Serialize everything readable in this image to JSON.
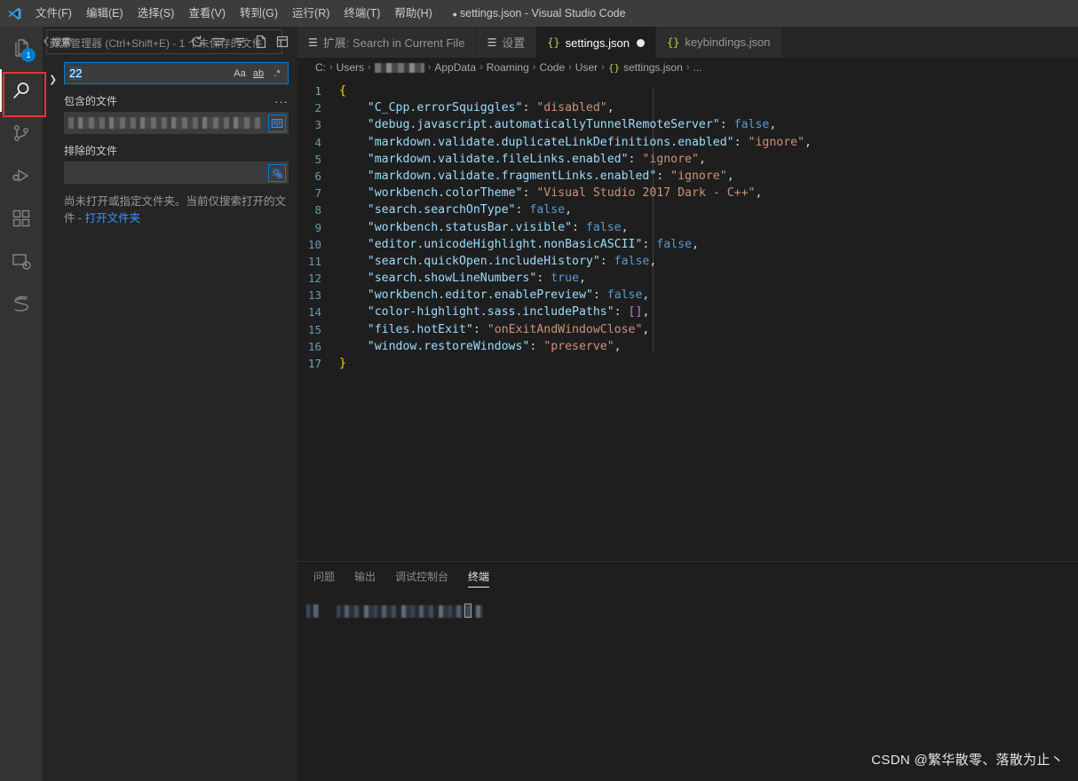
{
  "window": {
    "title": "settings.json - Visual Studio Code",
    "dirty_dot": "●",
    "logo_name": "vscode-logo"
  },
  "menubar": {
    "items": [
      {
        "label": "文件(F)",
        "name": "menu-file"
      },
      {
        "label": "编辑(E)",
        "name": "menu-edit"
      },
      {
        "label": "选择(S)",
        "name": "menu-selection"
      },
      {
        "label": "查看(V)",
        "name": "menu-view"
      },
      {
        "label": "转到(G)",
        "name": "menu-go"
      },
      {
        "label": "运行(R)",
        "name": "menu-run"
      },
      {
        "label": "终端(T)",
        "name": "menu-terminal"
      },
      {
        "label": "帮助(H)",
        "name": "menu-help"
      }
    ]
  },
  "activitybar": {
    "items": [
      {
        "icon": "files-explorer-icon",
        "active": false,
        "badge": "1"
      },
      {
        "icon": "search-icon",
        "active": true,
        "badge": ""
      },
      {
        "icon": "source-control-icon",
        "active": false,
        "badge": ""
      },
      {
        "icon": "run-and-debug-icon",
        "active": false,
        "badge": ""
      },
      {
        "icon": "extensions-icon",
        "active": false,
        "badge": ""
      },
      {
        "icon": "remote-explorer-icon",
        "active": false,
        "badge": ""
      },
      {
        "icon": "sass-icon",
        "active": false,
        "badge": ""
      }
    ],
    "annotation_color": "#e83333"
  },
  "sidebar": {
    "title": "搜索",
    "ghost_tooltip": "资源管理器 (Ctrl+Shift+E) - 1 个未保存的文件",
    "header_icons": [
      {
        "name": "refresh-icon"
      },
      {
        "name": "clear-search-results-icon"
      },
      {
        "name": "collapse-all-icon"
      },
      {
        "name": "open-new-search-editor-icon"
      },
      {
        "name": "view-as-tree-icon"
      }
    ],
    "toggle_details_arrow": "❯",
    "search": {
      "value": "22",
      "options": [
        {
          "label": "Aa",
          "name": "match-case-option"
        },
        {
          "label": "ab",
          "name": "match-whole-word-option"
        },
        {
          "label": ".*",
          "name": "use-regex-option"
        }
      ]
    },
    "files_to_include": {
      "label": "包含的文件",
      "value": "",
      "ellipsis": "...",
      "button_icon": "open-editors-icon"
    },
    "files_to_exclude": {
      "label": "排除的文件",
      "value": "",
      "button_icon": "settings-gear-exclude-icon"
    },
    "hint": {
      "text": "尚未打开或指定文件夹。当前仅搜索打开的文件 - ",
      "link": "打开文件夹"
    }
  },
  "editor": {
    "tabs": [
      {
        "label": "扩展: Search in Current File",
        "icon": "settings-lines-icon",
        "active": false,
        "dirty": false,
        "icon_kind": "lines"
      },
      {
        "label": "设置",
        "icon": "settings-lines-icon",
        "active": false,
        "dirty": false,
        "icon_kind": "lines"
      },
      {
        "label": "settings.json",
        "icon": "json-braces-icon",
        "active": true,
        "dirty": true,
        "icon_kind": "json"
      },
      {
        "label": "keybindings.json",
        "icon": "json-braces-icon",
        "active": false,
        "dirty": false,
        "icon_kind": "json"
      }
    ],
    "breadcrumb": [
      {
        "type": "text",
        "label": "C:"
      },
      {
        "type": "text",
        "label": "Users"
      },
      {
        "type": "redacted",
        "label": ""
      },
      {
        "type": "text",
        "label": "AppData"
      },
      {
        "type": "text",
        "label": "Roaming"
      },
      {
        "type": "text",
        "label": "Code"
      },
      {
        "type": "text",
        "label": "User"
      },
      {
        "type": "json",
        "label": "settings.json"
      },
      {
        "type": "text",
        "label": "..."
      }
    ],
    "breadcrumb_separator": "›",
    "code_lines": [
      {
        "n": "1",
        "tokens": [
          {
            "t": "{",
            "c": "brace"
          }
        ]
      },
      {
        "n": "2",
        "tokens": [
          {
            "t": "    \"C_Cpp.errorSquiggles\"",
            "c": "prop"
          },
          {
            "t": ": ",
            "c": "punc"
          },
          {
            "t": "\"disabled\"",
            "c": "str"
          },
          {
            "t": ",",
            "c": "punc"
          }
        ]
      },
      {
        "n": "3",
        "tokens": [
          {
            "t": "    \"debug.javascript.automaticallyTunnelRemoteServer\"",
            "c": "prop"
          },
          {
            "t": ": ",
            "c": "punc"
          },
          {
            "t": "false",
            "c": "bool"
          },
          {
            "t": ",",
            "c": "punc"
          }
        ]
      },
      {
        "n": "4",
        "tokens": [
          {
            "t": "    \"markdown.validate.duplicateLinkDefinitions.enabled\"",
            "c": "prop"
          },
          {
            "t": ": ",
            "c": "punc"
          },
          {
            "t": "\"ignore\"",
            "c": "str"
          },
          {
            "t": ",",
            "c": "punc"
          }
        ]
      },
      {
        "n": "5",
        "tokens": [
          {
            "t": "    \"markdown.validate.fileLinks.enabled\"",
            "c": "prop"
          },
          {
            "t": ": ",
            "c": "punc"
          },
          {
            "t": "\"ignore\"",
            "c": "str"
          },
          {
            "t": ",",
            "c": "punc"
          }
        ]
      },
      {
        "n": "6",
        "tokens": [
          {
            "t": "    \"markdown.validate.fragmentLinks.enabled\"",
            "c": "prop"
          },
          {
            "t": ": ",
            "c": "punc"
          },
          {
            "t": "\"ignore\"",
            "c": "str"
          },
          {
            "t": ",",
            "c": "punc"
          }
        ]
      },
      {
        "n": "7",
        "tokens": [
          {
            "t": "    \"workbench.colorTheme\"",
            "c": "prop"
          },
          {
            "t": ": ",
            "c": "punc"
          },
          {
            "t": "\"Visual Studio 2017 Dark - C++\"",
            "c": "str"
          },
          {
            "t": ",",
            "c": "punc"
          }
        ]
      },
      {
        "n": "8",
        "tokens": [
          {
            "t": "    \"search.searchOnType\"",
            "c": "prop"
          },
          {
            "t": ": ",
            "c": "punc"
          },
          {
            "t": "false",
            "c": "bool"
          },
          {
            "t": ",",
            "c": "punc"
          }
        ]
      },
      {
        "n": "9",
        "tokens": [
          {
            "t": "    \"workbench.statusBar.visible\"",
            "c": "prop"
          },
          {
            "t": ": ",
            "c": "punc"
          },
          {
            "t": "false",
            "c": "bool"
          },
          {
            "t": ",",
            "c": "punc"
          }
        ]
      },
      {
        "n": "10",
        "tokens": [
          {
            "t": "    \"editor.unicodeHighlight.nonBasicASCII\"",
            "c": "prop"
          },
          {
            "t": ": ",
            "c": "punc"
          },
          {
            "t": "false",
            "c": "bool"
          },
          {
            "t": ",",
            "c": "punc"
          }
        ]
      },
      {
        "n": "11",
        "tokens": [
          {
            "t": "    \"search.quickOpen.includeHistory\"",
            "c": "prop"
          },
          {
            "t": ": ",
            "c": "punc"
          },
          {
            "t": "false",
            "c": "bool"
          },
          {
            "t": ",",
            "c": "punc"
          }
        ]
      },
      {
        "n": "12",
        "tokens": [
          {
            "t": "    \"search.showLineNumbers\"",
            "c": "prop"
          },
          {
            "t": ": ",
            "c": "punc"
          },
          {
            "t": "true",
            "c": "bool"
          },
          {
            "t": ",",
            "c": "punc"
          }
        ]
      },
      {
        "n": "13",
        "tokens": [
          {
            "t": "    \"workbench.editor.enablePreview\"",
            "c": "prop"
          },
          {
            "t": ": ",
            "c": "punc"
          },
          {
            "t": "false",
            "c": "bool"
          },
          {
            "t": ",",
            "c": "punc"
          }
        ]
      },
      {
        "n": "14",
        "tokens": [
          {
            "t": "    \"color-highlight.sass.includePaths\"",
            "c": "prop"
          },
          {
            "t": ": ",
            "c": "punc"
          },
          {
            "t": "[]",
            "c": "brack"
          },
          {
            "t": ",",
            "c": "punc"
          }
        ]
      },
      {
        "n": "15",
        "tokens": [
          {
            "t": "    \"files.hotExit\"",
            "c": "prop"
          },
          {
            "t": ": ",
            "c": "punc"
          },
          {
            "t": "\"onExitAndWindowClose\"",
            "c": "str"
          },
          {
            "t": ",",
            "c": "punc"
          }
        ]
      },
      {
        "n": "16",
        "tokens": [
          {
            "t": "    \"window.restoreWindows\"",
            "c": "prop"
          },
          {
            "t": ": ",
            "c": "punc"
          },
          {
            "t": "\"preserve\"",
            "c": "str"
          },
          {
            "t": ",",
            "c": "punc"
          }
        ]
      },
      {
        "n": "17",
        "tokens": [
          {
            "t": "}",
            "c": "brace"
          }
        ]
      }
    ]
  },
  "panel": {
    "tabs": [
      {
        "label": "问题",
        "active": false
      },
      {
        "label": "输出",
        "active": false
      },
      {
        "label": "调试控制台",
        "active": false
      },
      {
        "label": "终端",
        "active": true
      }
    ],
    "terminal": {
      "content": "",
      "cursor": true
    }
  },
  "watermark": {
    "text": "CSDN @繁华散零、落散为止丶"
  },
  "colors": {
    "accent": "#007acc",
    "focus_border": "#007fd4",
    "editor_bg": "#1e1e1e",
    "sidebar_bg": "#252526",
    "activitybar_bg": "#333333",
    "titlebar_bg": "#3c3c3c",
    "annotation": "#e83333",
    "link": "#3794ff",
    "json_key": "#9cdcfe",
    "json_string": "#ce9178",
    "json_bool": "#569cd6",
    "json_brace": "#ffd700",
    "json_bracket": "#da70d6",
    "line_number": "#6a9ab0"
  }
}
